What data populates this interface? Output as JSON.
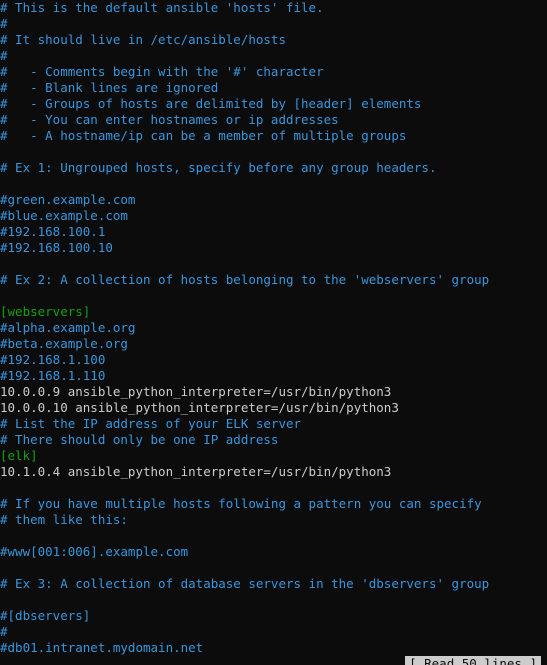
{
  "editor": {
    "lines": [
      {
        "text": "# This is the default ansible 'hosts' file.",
        "type": "comment"
      },
      {
        "text": "#",
        "type": "comment"
      },
      {
        "text": "# It should live in /etc/ansible/hosts",
        "type": "comment"
      },
      {
        "text": "#",
        "type": "comment"
      },
      {
        "text": "#   - Comments begin with the '#' character",
        "type": "comment"
      },
      {
        "text": "#   - Blank lines are ignored",
        "type": "comment"
      },
      {
        "text": "#   - Groups of hosts are delimited by [header] elements",
        "type": "comment"
      },
      {
        "text": "#   - You can enter hostnames or ip addresses",
        "type": "comment"
      },
      {
        "text": "#   - A hostname/ip can be a member of multiple groups",
        "type": "comment"
      },
      {
        "text": "",
        "type": "plain"
      },
      {
        "text": "# Ex 1: Ungrouped hosts, specify before any group headers.",
        "type": "comment"
      },
      {
        "text": "",
        "type": "plain"
      },
      {
        "text": "#green.example.com",
        "type": "comment"
      },
      {
        "text": "#blue.example.com",
        "type": "comment"
      },
      {
        "text": "#192.168.100.1",
        "type": "comment"
      },
      {
        "text": "#192.168.100.10",
        "type": "comment"
      },
      {
        "text": "",
        "type": "plain"
      },
      {
        "text": "# Ex 2: A collection of hosts belonging to the 'webservers' group",
        "type": "comment"
      },
      {
        "text": "",
        "type": "plain"
      },
      {
        "text": "[webservers]",
        "type": "header"
      },
      {
        "text": "#alpha.example.org",
        "type": "comment"
      },
      {
        "text": "#beta.example.org",
        "type": "comment"
      },
      {
        "text": "#192.168.1.100",
        "type": "comment"
      },
      {
        "text": "#192.168.1.110",
        "type": "comment"
      },
      {
        "text": "10.0.0.9 ansible_python_interpreter=/usr/bin/python3",
        "type": "plain"
      },
      {
        "text": "10.0.0.10 ansible_python_interpreter=/usr/bin/python3",
        "type": "plain"
      },
      {
        "text": "# List the IP address of your ELK server",
        "type": "comment"
      },
      {
        "text": "# There should only be one IP address",
        "type": "comment"
      },
      {
        "text": "[elk]",
        "type": "header"
      },
      {
        "text": "10.1.0.4 ansible_python_interpreter=/usr/bin/python3",
        "type": "plain"
      },
      {
        "text": "",
        "type": "plain"
      },
      {
        "text": "# If you have multiple hosts following a pattern you can specify",
        "type": "comment"
      },
      {
        "text": "# them like this:",
        "type": "comment"
      },
      {
        "text": "",
        "type": "plain"
      },
      {
        "text": "#www[001:006].example.com",
        "type": "comment"
      },
      {
        "text": "",
        "type": "plain"
      },
      {
        "text": "# Ex 3: A collection of database servers in the 'dbservers' group",
        "type": "comment"
      },
      {
        "text": "",
        "type": "plain"
      },
      {
        "text": "#[dbservers]",
        "type": "comment"
      },
      {
        "text": "#",
        "type": "comment"
      },
      {
        "text": "#db01.intranet.mydomain.net",
        "type": "comment"
      }
    ],
    "status_message": "[ Read 50 lines ]"
  },
  "colors": {
    "background": "#0c0c0c",
    "comment": "#3a96dd",
    "plain": "#cccccc",
    "header": "#13a10e"
  }
}
